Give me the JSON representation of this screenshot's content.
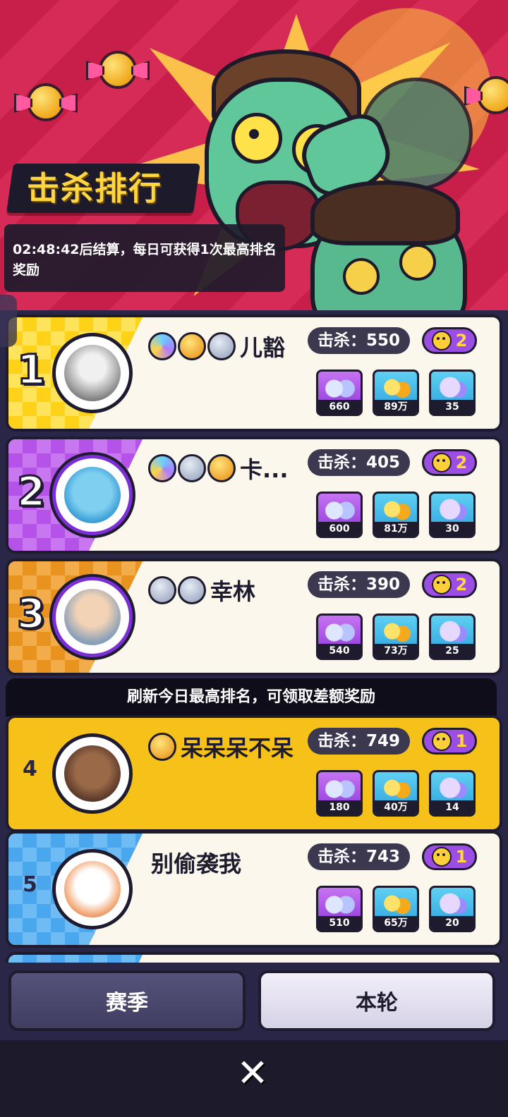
{
  "header": {
    "title": "击杀排行",
    "info": "02:48:42后结算，每日可获得1次最高排名奖励"
  },
  "notice": "刷新今日最高排名，可领取差额奖励",
  "kill_prefix": "击杀：",
  "entries": [
    {
      "rank": "1",
      "name": "儿豁",
      "kills": "550",
      "skulls": "2",
      "rewards": [
        "660",
        "89万",
        "35"
      ],
      "stripe": "gold",
      "badges": [
        "rainbow",
        "gold",
        "silver"
      ]
    },
    {
      "rank": "2",
      "name": "卡...",
      "kills": "405",
      "skulls": "2",
      "rewards": [
        "600",
        "81万",
        "30"
      ],
      "stripe": "purple",
      "badges": [
        "rainbow",
        "silver",
        "gold"
      ]
    },
    {
      "rank": "3",
      "name": "幸林",
      "kills": "390",
      "skulls": "2",
      "rewards": [
        "540",
        "73万",
        "25"
      ],
      "stripe": "orange",
      "badges": [
        "silver",
        "silver"
      ]
    },
    {
      "rank": "4",
      "name": "呆呆呆不呆",
      "kills": "749",
      "skulls": "1",
      "rewards": [
        "180",
        "40万",
        "14"
      ],
      "stripe": "none",
      "badges": [
        "gold"
      ]
    },
    {
      "rank": "5",
      "name": "别偷袭我",
      "kills": "743",
      "skulls": "1",
      "rewards": [
        "510",
        "65万",
        "20"
      ],
      "stripe": "blue",
      "badges": []
    }
  ],
  "tabs": {
    "season": "赛季",
    "round": "本轮"
  },
  "close_icon": "close-icon",
  "colors": {
    "accent": "#ffd541",
    "panel": "#2a2647",
    "card": "#fbf7ec",
    "highlight": "#f6c21a"
  }
}
